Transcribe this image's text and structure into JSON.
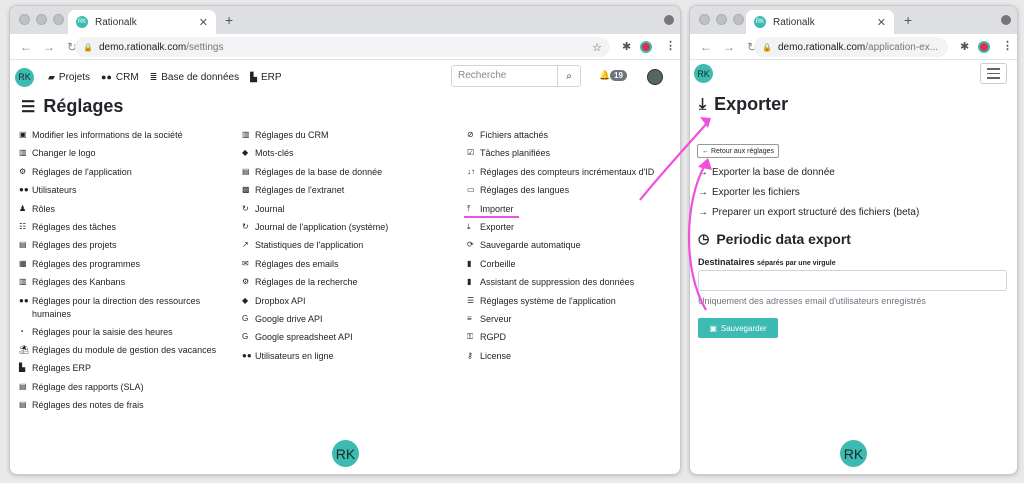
{
  "browser1": {
    "tab_title": "Rationalk",
    "url_host": "demo.rationalk.com",
    "url_path": "/settings"
  },
  "browser2": {
    "tab_title": "Rationalk",
    "url_host": "demo.rationalk.com",
    "url_path": "/application-ex..."
  },
  "favicon_text": "RK",
  "nav": {
    "avatar": "RK",
    "items": [
      {
        "label": "Projets",
        "icon": "folder-icon"
      },
      {
        "label": "CRM",
        "icon": "users-icon"
      },
      {
        "label": "Base de données",
        "icon": "database-icon"
      },
      {
        "label": "ERP",
        "icon": "industry-icon"
      }
    ],
    "search_placeholder": "Recherche",
    "notif_count": "19"
  },
  "settings": {
    "title": "Réglages",
    "col1": [
      "Modifier les informations de la société",
      "Changer le logo",
      "Réglages de l'application",
      "Utilisateurs",
      "Rôles",
      "Réglages des tâches",
      "Réglages des projets",
      "Réglages des programmes",
      "Réglages des Kanbans",
      "Réglages pour la direction des ressources humaines",
      "Réglages pour la saisie des heures",
      "Réglages du module de gestion des vacances",
      "Réglages ERP",
      "Réglage des rapports (SLA)",
      "Réglages des notes de frais"
    ],
    "col2": [
      "Réglages du CRM",
      "Mots-clés",
      "Réglages de la base de donnée",
      "Réglages de l'extranet",
      "Journal",
      "Journal de l'application (système)",
      "Statistiques de l'application",
      "Réglages des emails",
      "Réglages de la recherche",
      "Dropbox API",
      "Google drive API",
      "Google spreadsheet API",
      "Utilisateurs en ligne"
    ],
    "col3": [
      "Fichiers attachés",
      "Tâches planifiées",
      "Réglages des compteurs incrémentaux d'ID",
      "Réglages des langues",
      "Importer",
      "Exporter",
      "Sauvegarde automatique",
      "Corbeille",
      "Assistant de suppression des données",
      "Réglages système de l'application",
      "Serveur",
      "RGPD",
      "License"
    ]
  },
  "export": {
    "avatar": "RK",
    "title": "Exporter",
    "back_label": "Retour aux réglages",
    "links": [
      "Exporter la base de donnée",
      "Exporter les fichiers",
      "Preparer un export structuré des fichiers (beta)"
    ],
    "periodic_title": "Periodic data export",
    "recipients_label": "Destinataires",
    "recipients_hint": "séparés par une virgule",
    "help_text": "Uniquement des adresses email d'utilisateurs enregistrés",
    "save_label": "Sauvegarder"
  },
  "footer_avatar": "RK",
  "colors": {
    "accent": "#3dbbb2",
    "annotation": "#f04fe0"
  }
}
